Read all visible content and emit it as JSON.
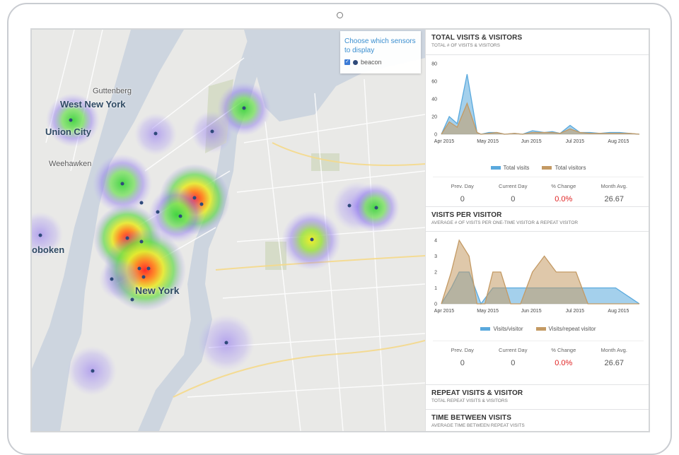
{
  "colors": {
    "accent": "#3b8fd0",
    "visits": "#5aa9dd",
    "visitors": "#c49a64",
    "change_red": "#e02424",
    "sensor_dot": "#2f4a7a"
  },
  "map": {
    "labels": {
      "west_new_york": "West New York",
      "guttenberg": "Guttenberg",
      "union_city": "Union City",
      "weehawken": "Weehawken",
      "hoboken": "oboken",
      "new_york": "New York"
    },
    "sensor_panel": {
      "title": "Choose which sensors to display",
      "checkbox_label": "beacon",
      "checked": true
    }
  },
  "panels": {
    "total_visits": {
      "title": "TOTAL VISITS & VISITORS",
      "subtitle": "TOTAL # OF VISITS & VISITORS",
      "legend": [
        "Total visits",
        "Total visitors"
      ],
      "stats": [
        {
          "label": "Prev. Day",
          "value": "0"
        },
        {
          "label": "Current Day",
          "value": "0"
        },
        {
          "label": "% Change",
          "value": "0.0%"
        },
        {
          "label": "Month Avg.",
          "value": "26.67"
        }
      ]
    },
    "visits_per_visitor": {
      "title": "VISITS PER VISITOR",
      "subtitle": "AVERAGE # OF VISITS PER ONE-TIME VISITOR & REPEAT VISITOR",
      "legend": [
        "Visits/visitor",
        "Visits/repeat visitor"
      ],
      "stats": [
        {
          "label": "Prev. Day",
          "value": "0"
        },
        {
          "label": "Current Day",
          "value": "0"
        },
        {
          "label": "% Change",
          "value": "0.0%"
        },
        {
          "label": "Month Avg.",
          "value": "26.67"
        }
      ]
    },
    "repeat_visits": {
      "title": "REPEAT VISITS & VISITOR",
      "subtitle": "TOTAL REPEAT VISITS & VISITORS"
    },
    "time_between": {
      "title": "TIME BETWEEN VISITS",
      "subtitle": "AVERAGE TIME BETWEEN REPEAT VISITS"
    }
  },
  "chart_data": [
    {
      "type": "area",
      "x_ticks": [
        "Apr 2015",
        "May 2015",
        "Jun 2015",
        "Jul 2015",
        "Aug 2015"
      ],
      "ylim": [
        0,
        80
      ],
      "y_ticks": [
        0,
        20,
        40,
        60,
        80
      ],
      "series": [
        {
          "name": "Total visits",
          "x": [
            0,
            4,
            8,
            13,
            18,
            20,
            24,
            28,
            32,
            37,
            41,
            46,
            52,
            56,
            60,
            65,
            70,
            75,
            80,
            85,
            90,
            95,
            100
          ],
          "values": [
            0,
            20,
            12,
            68,
            2,
            0,
            2,
            2,
            0,
            1,
            0,
            4,
            2,
            3,
            1,
            10,
            2,
            2,
            1,
            2,
            2,
            1,
            0
          ]
        },
        {
          "name": "Total visitors",
          "x": [
            0,
            4,
            8,
            13,
            18,
            20,
            24,
            28,
            32,
            37,
            41,
            46,
            52,
            56,
            60,
            65,
            70,
            75,
            80,
            85,
            90,
            95,
            100
          ],
          "values": [
            0,
            14,
            8,
            35,
            2,
            0,
            1,
            2,
            0,
            1,
            0,
            2,
            2,
            2,
            1,
            6,
            2,
            1,
            1,
            1,
            1,
            1,
            0
          ]
        }
      ]
    },
    {
      "type": "area",
      "x_ticks": [
        "Apr 2015",
        "May 2015",
        "Jun 2015",
        "Jul 2015",
        "Aug 2015"
      ],
      "ylim": [
        0,
        4
      ],
      "y_ticks": [
        0,
        1,
        2,
        3,
        4
      ],
      "series": [
        {
          "name": "Visits/visitor",
          "x": [
            0,
            5,
            9,
            14,
            20,
            26,
            30,
            38,
            46,
            55,
            62,
            68,
            74,
            88,
            100
          ],
          "values": [
            0,
            1,
            2,
            2,
            0,
            1,
            1,
            1,
            1,
            1,
            1,
            1,
            1,
            1,
            0
          ]
        },
        {
          "name": "Visits/repeat visitor",
          "x": [
            0,
            5,
            9,
            14,
            18,
            22,
            26,
            30,
            35,
            40,
            46,
            52,
            58,
            63,
            68,
            74,
            100
          ],
          "values": [
            0,
            2,
            4,
            3,
            0,
            0,
            2,
            2,
            0,
            0,
            2,
            3,
            2,
            2,
            2,
            0,
            0
          ]
        }
      ]
    }
  ]
}
